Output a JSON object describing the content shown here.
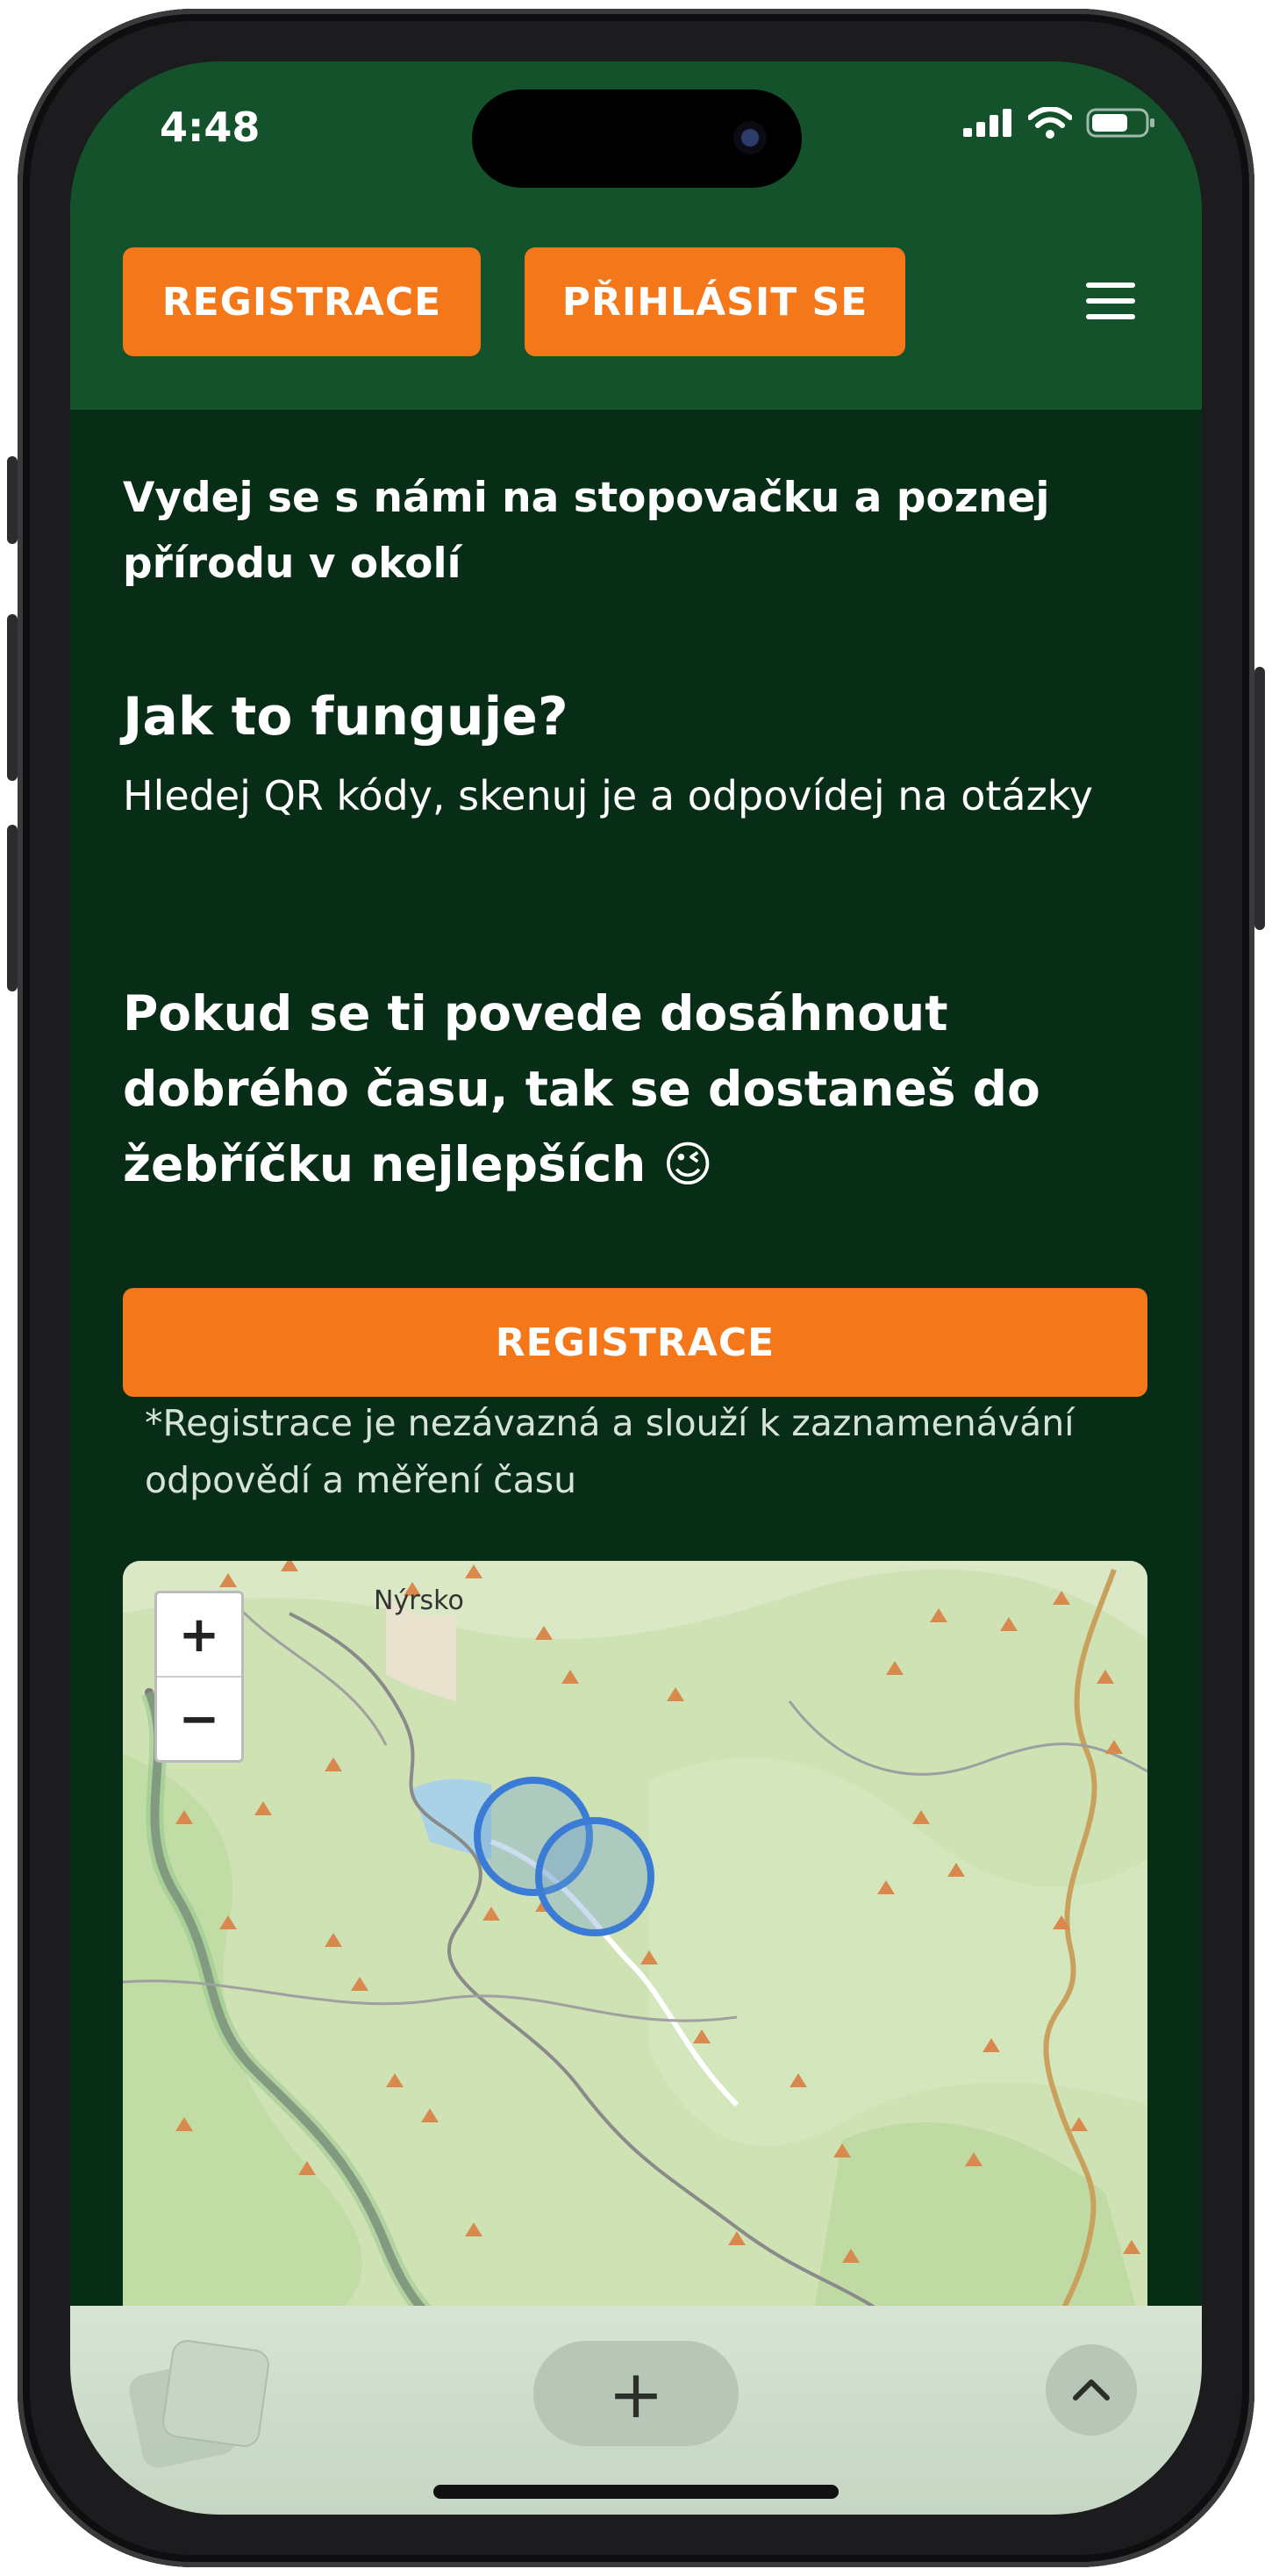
{
  "status_bar": {
    "time": "4:48"
  },
  "header": {
    "register_label": "REGISTRACE",
    "login_label": "PŘIHLÁSIT SE"
  },
  "content": {
    "intro": "Vydej se s námi na stopovačku a poznej přírodu v okolí",
    "how_title": "Jak to funguje?",
    "how_desc": "Hledej QR kódy, skenuj je a odpovídej na otázky",
    "hint": "Pokud se ti povede dosáhnout dobrého času, tak se dostaneš do žebříčku nejlepších 😉",
    "register_cta": "REGISTRACE",
    "note": "*Registrace je nezávazná a slouží k zaznamenávání odpovědí a měření času"
  },
  "map": {
    "place_label": "Nýrsko",
    "zoom_in": "+",
    "zoom_out": "−"
  },
  "browser_bar": {
    "new_tab": "+"
  },
  "colors": {
    "header_bg": "#14522c",
    "page_bg": "#082d17",
    "accent": "#f47719",
    "map_circle": "#3a7bd5"
  }
}
